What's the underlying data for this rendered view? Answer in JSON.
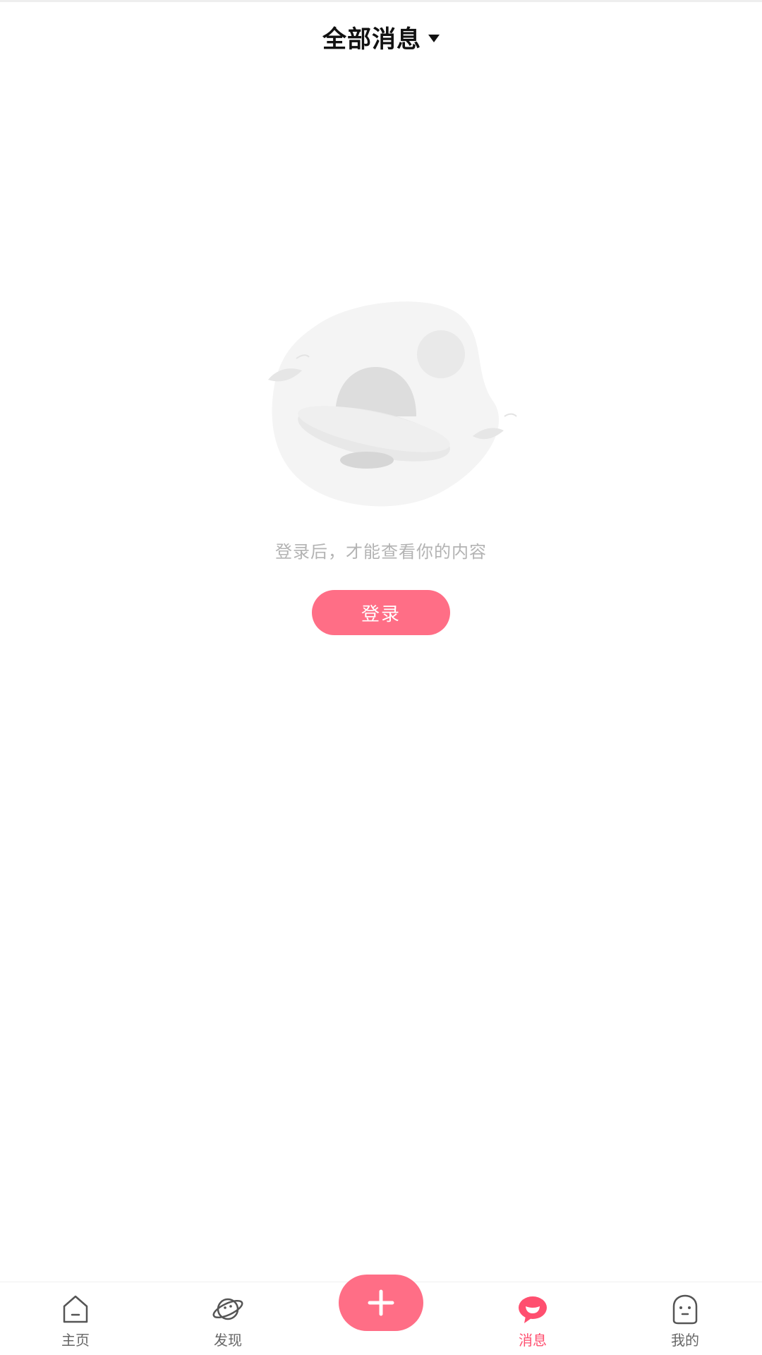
{
  "header": {
    "title": "全部消息"
  },
  "empty_state": {
    "message": "登录后，才能查看你的内容",
    "login_button_label": "登录",
    "illustration_icon": "ufo-planet-illustration"
  },
  "tabbar": {
    "tabs": [
      {
        "label": "主页",
        "icon": "home-icon",
        "active": false
      },
      {
        "label": "发现",
        "icon": "planet-icon",
        "active": false
      },
      {
        "label": "消息",
        "icon": "chat-bubble-icon",
        "active": true
      },
      {
        "label": "我的",
        "icon": "ghost-face-icon",
        "active": false
      }
    ],
    "add_button_icon": "plus-icon"
  },
  "colors": {
    "accent": "#ff6e86",
    "active_tab": "#ff4f6f",
    "muted_text": "#b3b3b3"
  }
}
